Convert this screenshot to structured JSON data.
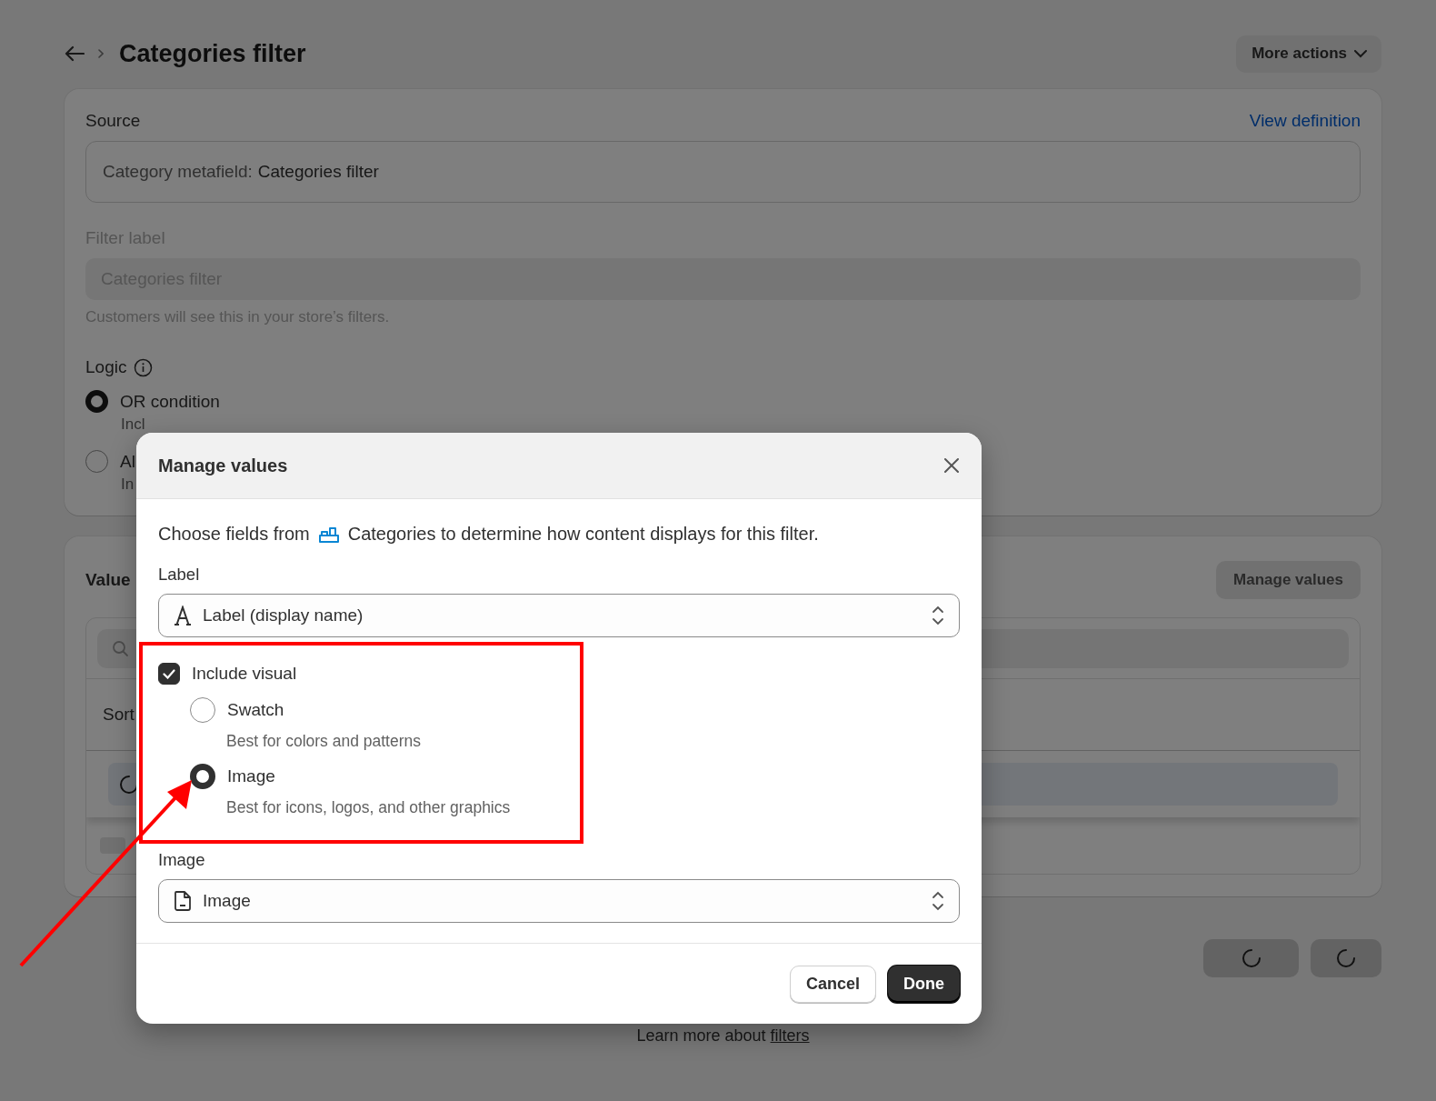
{
  "page": {
    "title": "Categories filter",
    "more_actions": "More actions",
    "source": {
      "label": "Source",
      "link": "View definition",
      "value_prefix": "Category metafield:",
      "value": "Categories filter"
    },
    "filter_label": {
      "label": "Filter label",
      "placeholder": "Categories filter",
      "help": "Customers will see this in your store’s filters."
    },
    "logic": {
      "label": "Logic",
      "options": [
        {
          "label": "OR condition",
          "description": "Incl",
          "selected": true
        },
        {
          "label": "Al",
          "description": "In",
          "selected": false
        }
      ]
    },
    "values": {
      "title": "Value",
      "manage_button": "Manage values",
      "sort_label": "Sort"
    },
    "footer": {
      "text": "Learn more about",
      "link": "filters"
    }
  },
  "modal": {
    "title": "Manage values",
    "intro_before": "Choose fields from",
    "intro_after": "Categories to determine how content displays for this filter.",
    "label_field": {
      "label": "Label",
      "value": "Label (display name)"
    },
    "include_visual": {
      "label": "Include visual",
      "checked": true
    },
    "visual_options": [
      {
        "label": "Swatch",
        "description": "Best for colors and patterns",
        "selected": false
      },
      {
        "label": "Image",
        "description": "Best for icons, logos, and other graphics",
        "selected": true
      }
    ],
    "image_field": {
      "label": "Image",
      "value": "Image"
    },
    "buttons": {
      "cancel": "Cancel",
      "done": "Done"
    }
  }
}
